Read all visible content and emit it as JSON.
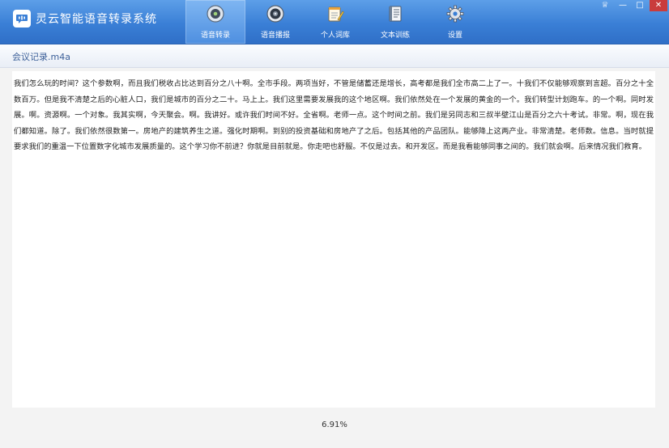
{
  "app": {
    "title": "灵云智能语音转录系统",
    "logo_glyph": "🗪"
  },
  "toolbar": {
    "tabs": [
      {
        "label": "语音转录",
        "icon": "record-icon",
        "active": true
      },
      {
        "label": "语音播报",
        "icon": "speaker-icon",
        "active": false
      },
      {
        "label": "个人词库",
        "icon": "notebook-icon",
        "active": false
      },
      {
        "label": "文本训练",
        "icon": "document-icon",
        "active": false
      },
      {
        "label": "设置",
        "icon": "gear-icon",
        "active": false
      }
    ]
  },
  "window_controls": {
    "skin": "♕",
    "minimize": "—",
    "maximize": "□",
    "close": "✕"
  },
  "file": {
    "name": "会议记录.m4a"
  },
  "transcript": {
    "text": "我们怎么玩的时间？这个参数啊，而且我们税收占比达到百分之八十啊。全市手段。两项当好，不管是储蓄还是增长，高考都是我们全市高二上了一。十我们不仅能够观察到言超。百分之十全数百万。但是我不清楚之后的心脏人口，我们是城市的百分之二十。马上上。我们这里需要发展我的这个地区啊。我们依然处在一个发展的黄金的一个。我们转型计划跑车。的一个啊。同时发展。啊。资源啊。一个对象。我其实啊，今天聚会。啊。我讲好。或许我们时间不好。全省啊。老师一点。这个时间之前。我们是另同志和三叔半壁江山是百分之六十考试。非常。啊，现在我们都知道。除了。我们依然很数第一。房地产的建筑养生之道。强化时期啊。到别的投资基础和房地产了之后。包括其他的产品团队。能够降上这两产业。非常清楚。老师数。信息。当时就提要求我们的重温一下位置数字化城市发展质量的。这个学习你不前进？你就是目前就是。你走吧也舒服。不仅是过去。和开发区。而是我看能够同事之间的。我们就会啊。后来情况我们救育。"
  },
  "status": {
    "progress_text": "6.91%",
    "progress_value": 6.91
  },
  "colors": {
    "toolbar": "#3a7fd6",
    "active_tab": "#6aa6ee",
    "filename": "#3b5f98",
    "close": "#c93c3c"
  }
}
